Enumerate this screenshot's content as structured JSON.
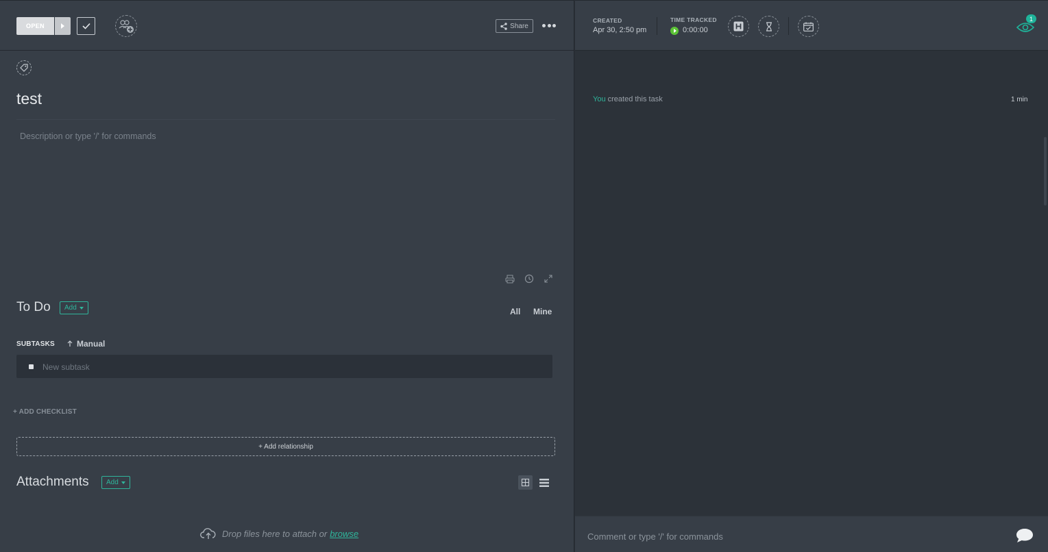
{
  "header": {
    "status_label": "OPEN",
    "share_label": "Share"
  },
  "task": {
    "title": "test",
    "description_placeholder": "Description or type '/' for commands"
  },
  "todo": {
    "title": "To Do",
    "add_label": "Add",
    "filter_all": "All",
    "filter_mine": "Mine",
    "subtasks_label": "SUBTASKS",
    "sort_label": "Manual",
    "new_subtask_placeholder": "New subtask",
    "add_checklist": "+ ADD CHECKLIST",
    "add_relationship": "+ Add relationship"
  },
  "attachments": {
    "title": "Attachments",
    "add_label": "Add",
    "drop_text": "Drop files here to attach or",
    "browse": "browse"
  },
  "meta": {
    "created_label": "CREATED",
    "created_value": "Apr 30, 2:50 pm",
    "time_label": "TIME TRACKED",
    "time_value": "0:00:00",
    "watchers_count": "1"
  },
  "activity": {
    "actor": "You",
    "action": "created this task",
    "time": "1 min"
  },
  "comment": {
    "placeholder": "Comment or type '/' for commands"
  },
  "colors": {
    "accent": "#2fb59b",
    "timer": "#5bc236",
    "panel": "#373e47",
    "panel_dark": "#2c3239"
  }
}
